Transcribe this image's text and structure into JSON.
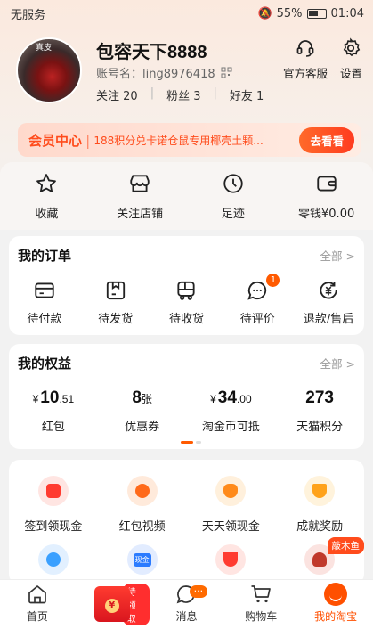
{
  "status": {
    "carrier": "无服务",
    "battery": "55%",
    "time": "01:04"
  },
  "profile": {
    "name": "包容天下8888",
    "account": "账号名：ling8976418",
    "following": "关注 20",
    "fans": "粉丝 3",
    "friends": "好友 1",
    "avatar_tag": "真皮"
  },
  "top_actions": [
    {
      "label": "官方客服",
      "icon": "headset-icon"
    },
    {
      "label": "设置",
      "icon": "gear-icon"
    }
  ],
  "banner": {
    "vip": "会员中心",
    "text": "188积分兑卡诺仓鼠专用椰壳土颗...",
    "button": "去看看"
  },
  "quick": [
    {
      "label": "收藏",
      "icon": "star-icon"
    },
    {
      "label": "关注店铺",
      "icon": "store-icon"
    },
    {
      "label": "足迹",
      "icon": "clock-icon"
    },
    {
      "label": "零钱¥0.00",
      "icon": "wallet-icon"
    }
  ],
  "orders": {
    "title": "我的订单",
    "all": "全部 >",
    "items": [
      {
        "label": "待付款",
        "icon": "card-icon"
      },
      {
        "label": "待发货",
        "icon": "box-icon"
      },
      {
        "label": "待收货",
        "icon": "truck-icon"
      },
      {
        "label": "待评价",
        "icon": "comment-icon",
        "badge": "1"
      },
      {
        "label": "退款/售后",
        "icon": "refund-icon"
      }
    ]
  },
  "rights": {
    "title": "我的权益",
    "all": "全部 >",
    "items": [
      {
        "cur": "¥",
        "main": "10",
        "suffix": ".51",
        "label": "红包"
      },
      {
        "cur": "",
        "main": "8",
        "suffix": "张",
        "label": "优惠券"
      },
      {
        "cur": "¥",
        "main": "34",
        "suffix": ".00",
        "label": "淘金币可抵"
      },
      {
        "cur": "",
        "main": "273",
        "suffix": "",
        "label": "天猫积分"
      }
    ]
  },
  "features": [
    {
      "label": "签到领现金",
      "icon": "red-envelope-icon",
      "color": "#ff3b30"
    },
    {
      "label": "红包视频",
      "icon": "play-icon",
      "color": "#ff6a1a"
    },
    {
      "label": "天天领现金",
      "icon": "money-bag-icon",
      "color": "#ff8a1a"
    },
    {
      "label": "成就奖励",
      "icon": "trophy-icon",
      "color": "#ffa21a"
    }
  ],
  "features2": [
    {
      "icon": "mascot-icon",
      "color": "#3aa0ff"
    },
    {
      "icon": "gold-card-icon",
      "color": "#2b7bff",
      "text": "现金"
    },
    {
      "icon": "magnet-icon",
      "color": "#ff3b30"
    },
    {
      "icon": "buddha-icon",
      "color": "#c0392b",
      "corner": "敲木鱼"
    }
  ],
  "tabs": [
    {
      "label": "首页",
      "icon": "home-icon"
    },
    {
      "label": "",
      "icon": "red-packet-icon",
      "tag": "待领取",
      "coin": "¥"
    },
    {
      "label": "消息",
      "icon": "message-icon",
      "badge": "···"
    },
    {
      "label": "购物车",
      "icon": "cart-icon"
    },
    {
      "label": "我的淘宝",
      "icon": "me-icon"
    }
  ]
}
